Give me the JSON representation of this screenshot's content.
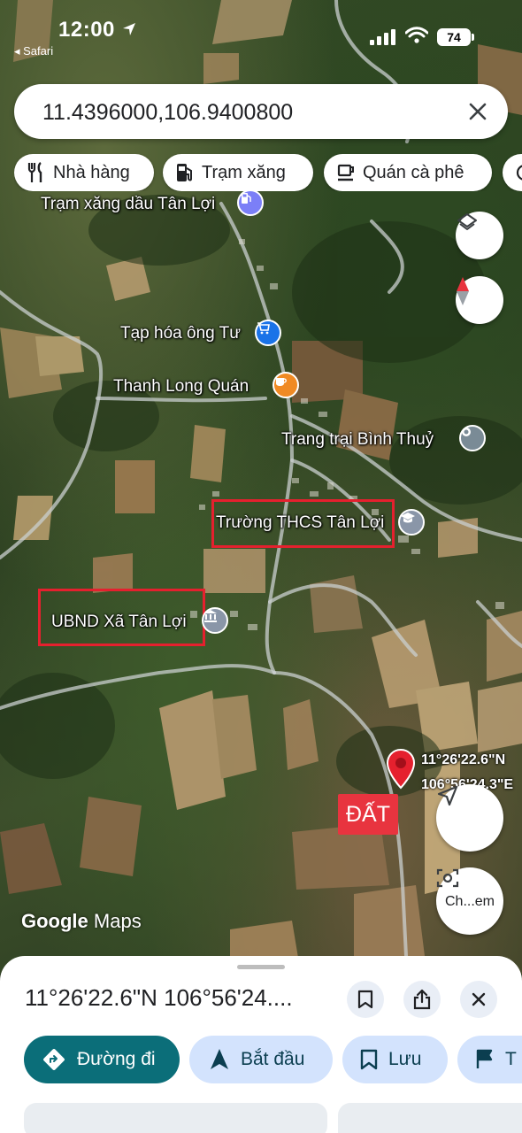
{
  "status_bar": {
    "time": "12:00",
    "back_app": "◂ Safari",
    "battery": "74"
  },
  "search": {
    "query": "11.4396000,106.9400800"
  },
  "chips": [
    {
      "label": "Nhà hàng",
      "icon": "fork-knife-icon"
    },
    {
      "label": "Trạm xăng",
      "icon": "gas-station-icon"
    },
    {
      "label": "Quán cà phê",
      "icon": "coffee-icon"
    }
  ],
  "map": {
    "places": [
      {
        "name": "Trạm xăng dầu Tân Lợi",
        "icon": "gas-pin-icon",
        "color": "#7b7ff7"
      },
      {
        "name": "Tạp hóa ông Tư",
        "icon": "cart-pin-icon",
        "color": "#1a73e8"
      },
      {
        "name": "Thanh Long Quán",
        "icon": "coffee-pin-icon",
        "color": "#f08a24"
      },
      {
        "name": "Trang trại Bình Thuỷ",
        "icon": "place-pin-icon",
        "color": "#7a8b96"
      },
      {
        "name": "Trường THCS Tân Lợi",
        "icon": "school-pin-icon",
        "color": "#8a96a8"
      },
      {
        "name": "UBND Xã Tân Lợi",
        "icon": "government-pin-icon",
        "color": "#8a96a8"
      }
    ],
    "marker": {
      "label": "ĐẤT",
      "lat": "11°26'22.6\"N",
      "lng": "106°56'24.3\"E",
      "color": "#e5202e"
    },
    "camera_button_label": "Ch...em",
    "attribution_google": "Google",
    "attribution_maps": "Maps"
  },
  "sheet": {
    "title": "11°26'22.6\"N 106°56'24....",
    "actions": [
      {
        "label": "Đường đi",
        "icon": "directions-icon"
      },
      {
        "label": "Bắt đầu",
        "icon": "navigation-arrow-icon"
      },
      {
        "label": "Lưu",
        "icon": "bookmark-icon"
      },
      {
        "label": "T",
        "icon": "flag-icon"
      }
    ]
  },
  "colors": {
    "accent": "#0b6e79",
    "chip_bg": "#d3e3fd",
    "highlight_box": "#e5202e"
  }
}
